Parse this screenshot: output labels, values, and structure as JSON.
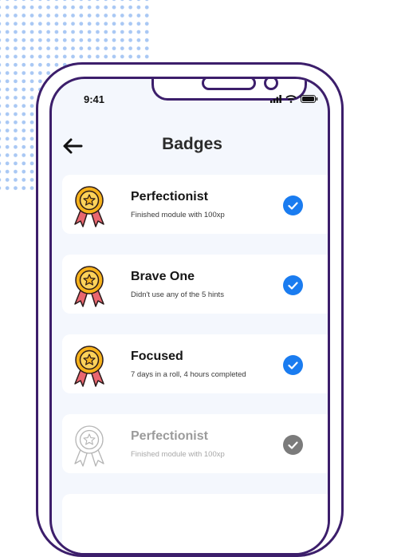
{
  "status_bar": {
    "time": "9:41"
  },
  "header": {
    "title": "Badges"
  },
  "badges": [
    {
      "name": "Perfectionist",
      "description": "Finished module with 100xp",
      "status": "earned",
      "medal_icon": "gold-medal-icon"
    },
    {
      "name": "Brave One",
      "description": "Didn't use any of the 5 hints",
      "status": "earned",
      "medal_icon": "gold-medal-icon"
    },
    {
      "name": "Focused",
      "description": "7 days in a roll, 4 hours completed",
      "status": "earned",
      "medal_icon": "gold-medal-icon"
    },
    {
      "name": "Perfectionist",
      "description": "Finished module with 100xp",
      "status": "locked",
      "medal_icon": "outline-medal-icon"
    }
  ],
  "colors": {
    "phone_frame": "#3c1e6b",
    "check_earned": "#1a7cf0",
    "check_locked": "#7b7b7b",
    "medal_gold": "#f6b21b",
    "ribbon": "#e9666f"
  }
}
